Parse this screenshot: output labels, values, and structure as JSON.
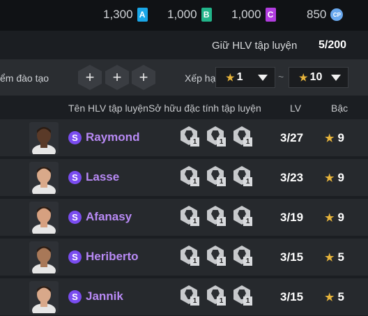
{
  "currencies": [
    {
      "value": "1,300",
      "tag": "A",
      "color": "#1aa7e8"
    },
    {
      "value": "1,000",
      "tag": "B",
      "color": "#22b58a"
    },
    {
      "value": "1,000",
      "tag": "C",
      "color": "#b23de0"
    },
    {
      "value": "850",
      "tag": "CP",
      "color": "#6aa8ee"
    }
  ],
  "keep": {
    "label": "Giữ HLV tập luyện",
    "count": "5/200"
  },
  "filter": {
    "label": "ểm đào tạo",
    "slots": [
      "+",
      "+",
      "+"
    ],
    "sort_label": "Xếp hạ",
    "range_from": "1",
    "range_sep": "~",
    "range_to": "10"
  },
  "columns": {
    "name": "Tên HLV tập luyện",
    "traits": "Sở hữu đặc tính tập luyện",
    "lv": "LV",
    "rank": "Bậc"
  },
  "coaches": [
    {
      "badge": "S",
      "name": "Raymond",
      "lv": "3/27",
      "rank": "9",
      "skin": "#5a3a28",
      "traits": [
        "1",
        "1",
        "1"
      ]
    },
    {
      "badge": "S",
      "name": "Lasse",
      "lv": "3/23",
      "rank": "9",
      "skin": "#d9a98a",
      "traits": [
        "1",
        "1",
        "1"
      ]
    },
    {
      "badge": "S",
      "name": "Afanasy",
      "lv": "3/19",
      "rank": "9",
      "skin": "#d6a080",
      "traits": [
        "1",
        "1",
        "1"
      ]
    },
    {
      "badge": "S",
      "name": "Heriberto",
      "lv": "3/15",
      "rank": "5",
      "skin": "#a87858",
      "traits": [
        "1",
        "1",
        "1"
      ]
    },
    {
      "badge": "S",
      "name": "Jannik",
      "lv": "3/15",
      "rank": "5",
      "skin": "#d8a88a",
      "traits": [
        "1",
        "1",
        "1"
      ]
    }
  ]
}
